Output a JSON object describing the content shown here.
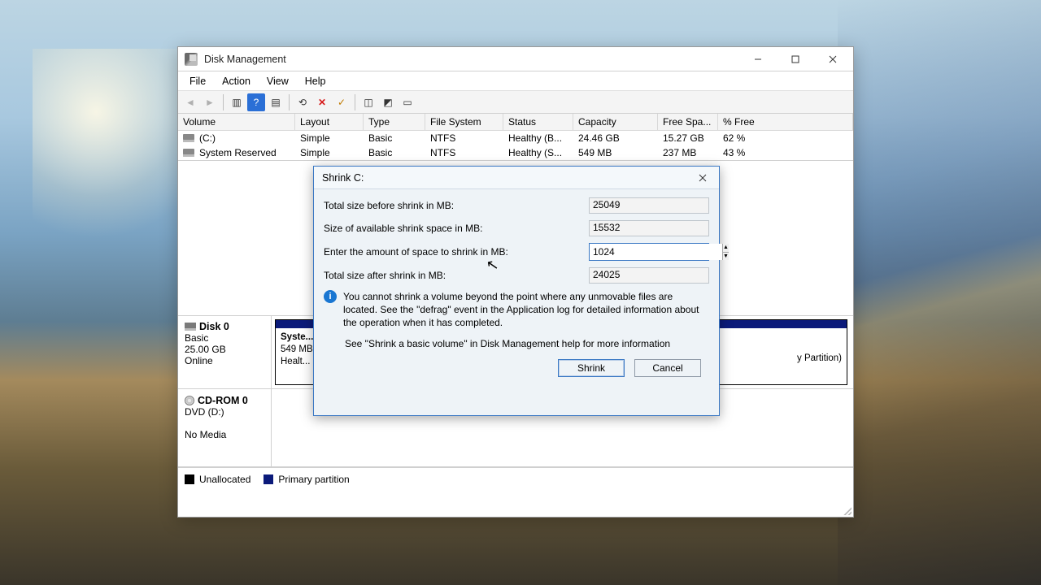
{
  "window": {
    "title": "Disk Management",
    "menu": [
      "File",
      "Action",
      "View",
      "Help"
    ]
  },
  "columns": [
    "Volume",
    "Layout",
    "Type",
    "File System",
    "Status",
    "Capacity",
    "Free Spa...",
    "% Free"
  ],
  "volumes": [
    {
      "name": "(C:)",
      "layout": "Simple",
      "type": "Basic",
      "fs": "NTFS",
      "status": "Healthy (B...",
      "capacity": "24.46 GB",
      "free": "15.27 GB",
      "pct": "62 %"
    },
    {
      "name": "System Reserved",
      "layout": "Simple",
      "type": "Basic",
      "fs": "NTFS",
      "status": "Healthy (S...",
      "capacity": "549 MB",
      "free": "237 MB",
      "pct": "43 %"
    }
  ],
  "disk0": {
    "title": "Disk 0",
    "type": "Basic",
    "size": "25.00 GB",
    "state": "Online",
    "p1": {
      "name": "Syste...",
      "size": "549 MB",
      "health": "Healt..."
    },
    "p2": {
      "tail": "y Partition)"
    }
  },
  "cdrom": {
    "title": "CD-ROM 0",
    "label": "DVD (D:)",
    "state": "No Media"
  },
  "legend": {
    "unallocated": "Unallocated",
    "primary": "Primary partition"
  },
  "dialog": {
    "title": "Shrink C:",
    "labels": {
      "total_before": "Total size before shrink in MB:",
      "available": "Size of available shrink space in MB:",
      "enter": "Enter the amount of space to shrink in MB:",
      "total_after": "Total size after shrink in MB:"
    },
    "values": {
      "total_before": "25049",
      "available": "15532",
      "enter": "1024",
      "total_after": "24025"
    },
    "info": "You cannot shrink a volume beyond the point where any unmovable files are located. See the \"defrag\" event in the Application log for detailed information about the operation when it has completed.",
    "see": "See \"Shrink a basic volume\" in Disk Management help for more information",
    "buttons": {
      "ok": "Shrink",
      "cancel": "Cancel"
    }
  }
}
